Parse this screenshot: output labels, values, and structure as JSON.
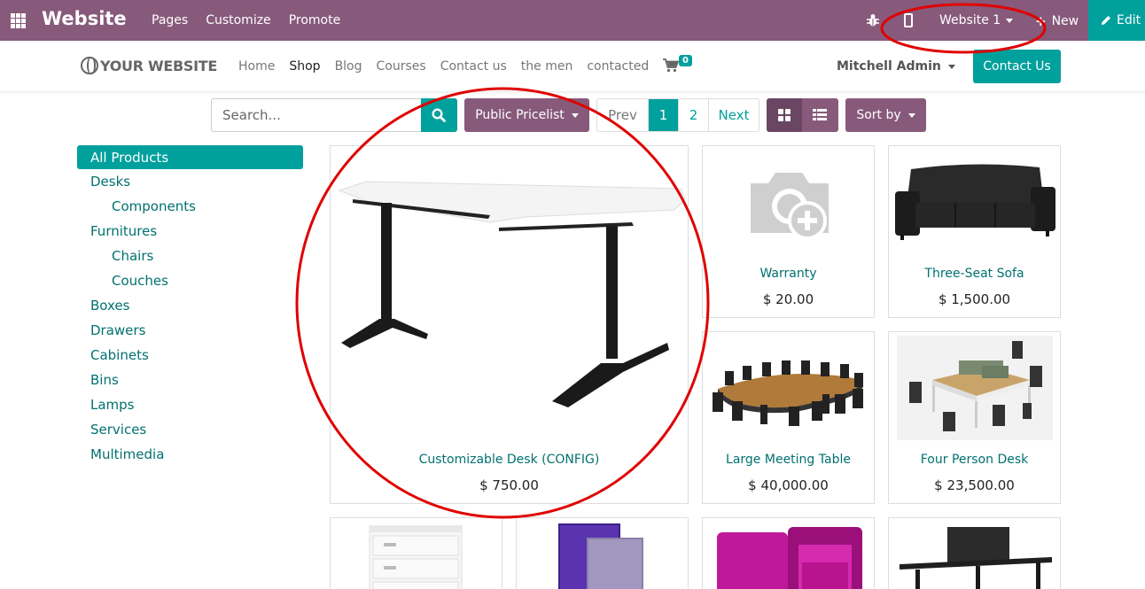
{
  "admin": {
    "brand": "Website",
    "menu": [
      "Pages",
      "Customize",
      "Promote"
    ],
    "website_switcher": "Website 1",
    "new_label": "New",
    "edit_label": "Edit"
  },
  "site": {
    "logo_text": "YOUR WEBSITE",
    "menu": [
      "Home",
      "Shop",
      "Blog",
      "Courses",
      "Contact us",
      "the men",
      "contacted"
    ],
    "active_menu": "Shop",
    "cart_count": "0",
    "user": "Mitchell Admin",
    "contact_button": "Contact Us"
  },
  "toolbar": {
    "search_placeholder": "Search...",
    "pricelist": "Public Pricelist",
    "pager": {
      "prev": "Prev",
      "pages": [
        "1",
        "2"
      ],
      "current": "1",
      "next": "Next"
    },
    "sort_label": "Sort by"
  },
  "categories": [
    {
      "label": "All Products",
      "active": true
    },
    {
      "label": "Desks"
    },
    {
      "label": "Components",
      "sub": true
    },
    {
      "label": "Furnitures"
    },
    {
      "label": "Chairs",
      "sub": true
    },
    {
      "label": "Couches",
      "sub": true
    },
    {
      "label": "Boxes"
    },
    {
      "label": "Drawers"
    },
    {
      "label": "Cabinets"
    },
    {
      "label": "Bins"
    },
    {
      "label": "Lamps"
    },
    {
      "label": "Services"
    },
    {
      "label": "Multimedia"
    }
  ],
  "products": [
    {
      "name": "Customizable Desk (CONFIG)",
      "price": "$ 750.00",
      "image": "desk-image"
    },
    {
      "name": "Warranty",
      "price": "$ 20.00",
      "image": "camera-placeholder-icon"
    },
    {
      "name": "Three-Seat Sofa",
      "price": "$ 1,500.00",
      "image": "sofa-image"
    },
    {
      "name": "Large Meeting Table",
      "price": "$ 40,000.00",
      "image": "meeting-table-image"
    },
    {
      "name": "Four Person Desk",
      "price": "$ 23,500.00",
      "image": "four-person-desk-image"
    }
  ],
  "partial_products": [
    "drawer-cabinet-image",
    "acoustic-panel-image",
    "pink-booth-image",
    "standing-desk-image"
  ],
  "colors": {
    "odoo_purple": "#875a7b",
    "teal": "#00a09d",
    "annotation_red": "#e00000"
  }
}
